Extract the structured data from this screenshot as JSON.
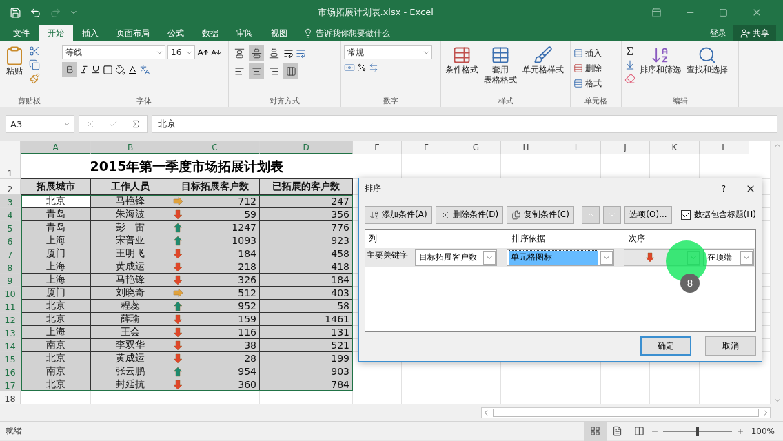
{
  "window": {
    "title": "_市场拓展计划表.xlsx - Excel"
  },
  "tabs": [
    {
      "label": "文件",
      "selected": false
    },
    {
      "label": "开始",
      "selected": true
    },
    {
      "label": "插入",
      "selected": false
    },
    {
      "label": "页面布局",
      "selected": false
    },
    {
      "label": "公式",
      "selected": false
    },
    {
      "label": "数据",
      "selected": false
    },
    {
      "label": "审阅",
      "selected": false
    },
    {
      "label": "视图",
      "selected": false
    }
  ],
  "tell_me": "告诉我你想要做什么",
  "account": {
    "login": "登录",
    "share": "共享"
  },
  "ribbon": {
    "clipboard": {
      "paste": "粘贴",
      "label": "剪贴板"
    },
    "font": {
      "name": "等线",
      "size": "16",
      "bold": true,
      "label": "字体"
    },
    "alignment": {
      "vertical": [
        {
          "kind": "top",
          "selected": false
        },
        {
          "kind": "middle",
          "selected": true
        },
        {
          "kind": "bottom",
          "selected": false
        }
      ],
      "horizontal": [
        {
          "kind": "left",
          "selected": false
        },
        {
          "kind": "center",
          "selected": true
        },
        {
          "kind": "right",
          "selected": false
        }
      ],
      "merge": true,
      "label": "对齐方式"
    },
    "number": {
      "format": "常规",
      "label": "数字"
    },
    "styles": {
      "conditional": "条件格式",
      "table_line1": "套用",
      "table_line2": "表格格式",
      "cell_styles": "单元格样式",
      "label": "样式"
    },
    "cells": {
      "insert": "插入",
      "delete": "删除",
      "format": "格式",
      "label": "单元格"
    },
    "editing": {
      "sort": "排序和筛选",
      "find": "查找和选择",
      "label": "编辑"
    }
  },
  "formula_bar": {
    "name_box": "A3",
    "value": "北京"
  },
  "sheet": {
    "columns": [
      "A",
      "B",
      "C",
      "D",
      "E",
      "F",
      "G",
      "H",
      "I",
      "J",
      "K",
      "L"
    ],
    "row_numbers": [
      "1",
      "2",
      "3",
      "4",
      "5",
      "6",
      "7",
      "8",
      "9",
      "10",
      "11",
      "12",
      "13",
      "14",
      "15",
      "16",
      "17",
      "18"
    ],
    "title": "2015年第一季度市场拓展计划表",
    "headers": [
      "拓展城市",
      "工作人员",
      "目标拓展客户数",
      "已拓展的客户数"
    ],
    "rows": [
      {
        "city": "北京",
        "person": "马艳锋",
        "kind": "right",
        "target": "712",
        "done": "247",
        "active": true
      },
      {
        "city": "青岛",
        "person": "朱海波",
        "kind": "down",
        "target": "59",
        "done": "356",
        "active": false
      },
      {
        "city": "青岛",
        "person": "彭　雷",
        "kind": "up",
        "target": "1247",
        "done": "776",
        "active": false
      },
      {
        "city": "上海",
        "person": "宋普亚",
        "kind": "up",
        "target": "1093",
        "done": "923",
        "active": false
      },
      {
        "city": "厦门",
        "person": "王明飞",
        "kind": "down",
        "target": "184",
        "done": "458",
        "active": false
      },
      {
        "city": "上海",
        "person": "黄成运",
        "kind": "down",
        "target": "218",
        "done": "418",
        "active": false
      },
      {
        "city": "上海",
        "person": "马艳锋",
        "kind": "down",
        "target": "326",
        "done": "184",
        "active": false
      },
      {
        "city": "厦门",
        "person": "刘晓奇",
        "kind": "right",
        "target": "512",
        "done": "403",
        "active": false
      },
      {
        "city": "北京",
        "person": "程蕊",
        "kind": "up",
        "target": "952",
        "done": "58",
        "active": false
      },
      {
        "city": "北京",
        "person": "薛瑜",
        "kind": "down",
        "target": "159",
        "done": "1461",
        "active": false
      },
      {
        "city": "上海",
        "person": "王会",
        "kind": "down",
        "target": "116",
        "done": "131",
        "active": false
      },
      {
        "city": "南京",
        "person": "李双华",
        "kind": "down",
        "target": "38",
        "done": "521",
        "active": false
      },
      {
        "city": "北京",
        "person": "黄成运",
        "kind": "down",
        "target": "28",
        "done": "199",
        "active": false
      },
      {
        "city": "南京",
        "person": "张云鹏",
        "kind": "up",
        "target": "954",
        "done": "903",
        "active": false
      },
      {
        "city": "北京",
        "person": "封延抗",
        "kind": "down",
        "target": "360",
        "done": "784",
        "active": false
      }
    ]
  },
  "dialog": {
    "title": "排序",
    "help": "?",
    "toolbar": [
      {
        "kind": "add",
        "label": "添加条件(A)"
      },
      {
        "kind": "delete",
        "label": "删除条件(D)"
      },
      {
        "kind": "copy",
        "label": "复制条件(C)"
      },
      {
        "kind": "up"
      },
      {
        "kind": "down"
      },
      {
        "kind": "options",
        "label": "选项(O)..."
      }
    ],
    "header_checkbox": {
      "label": "数据包含标题(H)",
      "checked": true
    },
    "columns": [
      "列",
      "排序依据",
      "次序"
    ],
    "rule": {
      "label": "主要关键字",
      "column": "目标拓展客户数",
      "sort_on": "单元格图标",
      "order": {
        "kind": "down"
      },
      "position": "在顶端"
    },
    "buttons": [
      {
        "label": "确定",
        "primary": true
      },
      {
        "label": "取消",
        "primary": false
      }
    ],
    "step": "8"
  },
  "status_bar": {
    "text": "就绪",
    "zoom": "100%",
    "level": 0.5
  }
}
